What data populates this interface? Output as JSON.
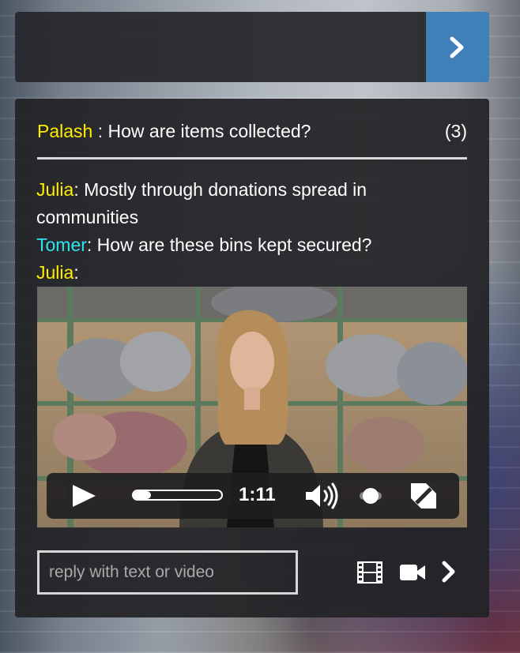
{
  "question": {
    "asker": "Palash",
    "separator": " : ",
    "text": "How are items collected?",
    "count": "(3)"
  },
  "thread": [
    {
      "name": "Julia",
      "name_color": "yellow",
      "text": ": Mostly through donations spread in communities"
    },
    {
      "name": "Tomer",
      "name_color": "cyan",
      "text": ": How are these bins kept secured?"
    },
    {
      "name": "Julia",
      "name_color": "yellow",
      "text": ":"
    }
  ],
  "video": {
    "time": "1:11",
    "progress": 0.2,
    "volume_level": 0.5
  },
  "reply": {
    "placeholder": "reply with text or video",
    "value": ""
  },
  "icons": {
    "top_next": "chevron-right-icon",
    "play": "play-icon",
    "volume": "volume-icon",
    "fullscreen": "fullscreen-icon",
    "film": "film-icon",
    "camera": "video-camera-icon",
    "send": "chevron-right-icon"
  },
  "colors": {
    "accent": "#3f80b8",
    "asker": "#ffee00",
    "name_yellow": "#ffee00",
    "name_cyan": "#2de4f0"
  }
}
